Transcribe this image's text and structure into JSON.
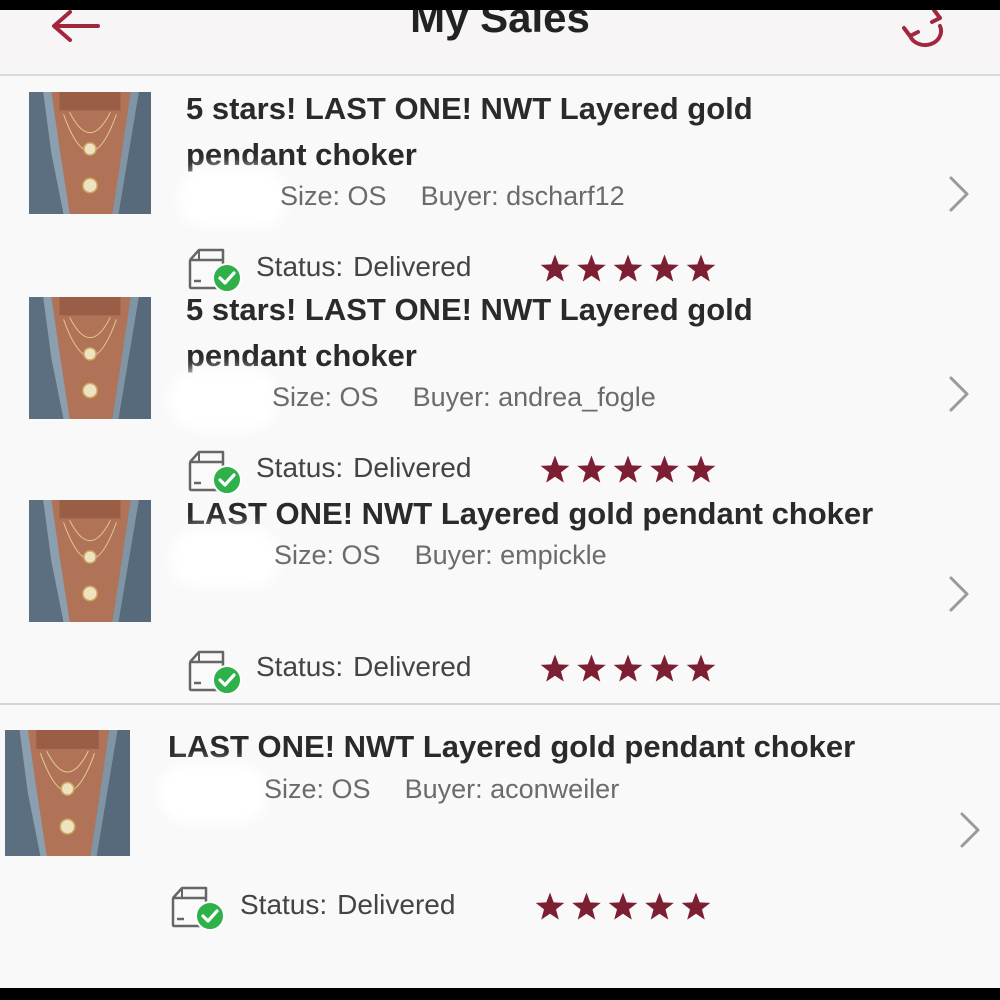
{
  "header": {
    "title": "My Sales",
    "back_icon": "back-arrow-icon",
    "refresh_icon": "refresh-icon",
    "accent_color": "#a3263f"
  },
  "sales": [
    {
      "title": "5 stars! LAST ONE! NWT Layered gold pendant choker",
      "size_label": "Size:",
      "size": "OS",
      "buyer_label": "Buyer:",
      "buyer": "dscharf12",
      "status_label": "Status:",
      "status": "Delivered",
      "rating": 5
    },
    {
      "title": "5 stars! LAST ONE! NWT Layered gold pendant choker",
      "size_label": "Size:",
      "size": "OS",
      "buyer_label": "Buyer:",
      "buyer": "andrea_fogle",
      "status_label": "Status:",
      "status": "Delivered",
      "rating": 5
    },
    {
      "title": "LAST ONE! NWT Layered gold pendant choker",
      "size_label": "Size:",
      "size": "OS",
      "buyer_label": "Buyer:",
      "buyer": "empickle",
      "status_label": "Status:",
      "status": "Delivered",
      "rating": 5
    },
    {
      "title": "LAST ONE! NWT Layered gold pendant choker",
      "size_label": "Size:",
      "size": "OS",
      "buyer_label": "Buyer:",
      "buyer": "aconweiler",
      "status_label": "Status:",
      "status": "Delivered",
      "rating": 5
    }
  ],
  "colors": {
    "star": "#7d1f33",
    "delivered_check": "#2fb14a"
  }
}
